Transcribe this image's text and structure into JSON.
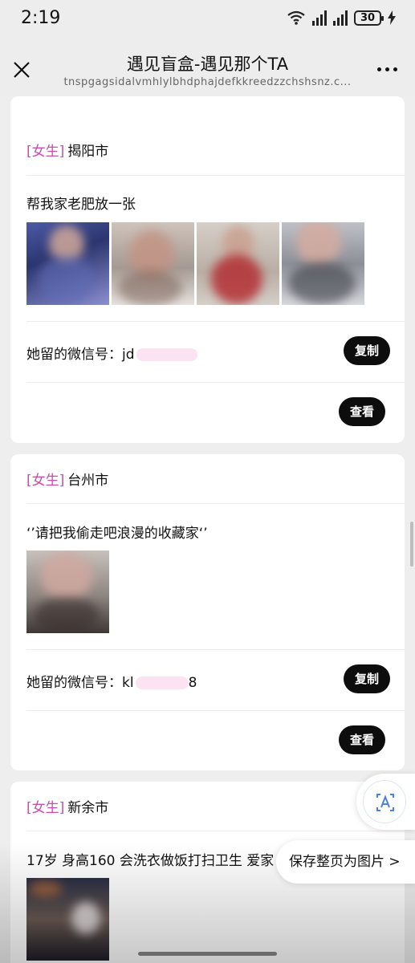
{
  "status_bar": {
    "time": "2:19",
    "battery": "30"
  },
  "title_bar": {
    "title": "遇见盲盒-遇见那个TA",
    "url": "tnspgagsidalvmhlylbhdphajdefkkreedzzchshsnz.c..."
  },
  "cards": [
    {
      "tag": "[女生]",
      "city": "揭阳市",
      "description": "帮我家老肥放一张",
      "wechat_label": "她留的微信号：",
      "wechat_prefix": "jd",
      "copy_label": "复制",
      "view_label": "查看"
    },
    {
      "tag": "[女生]",
      "city": "台州市",
      "description": "‘’请把我偷走吧浪漫的收藏家‘’",
      "wechat_label": "她留的微信号：",
      "wechat_prefix": "kl",
      "wechat_suffix": "8",
      "copy_label": "复制",
      "view_label": "查看"
    },
    {
      "tag": "[女生]",
      "city": "新余市",
      "description": "17岁 身高160 会洗衣做饭打扫卫生 爱家"
    }
  ],
  "overlays": {
    "save_page_label": "保存整页为图片 >"
  },
  "colors": {
    "tag": "#c44fb0",
    "button": "#0d0d0d",
    "card": "#ffffff",
    "background": "#eeeeee"
  }
}
